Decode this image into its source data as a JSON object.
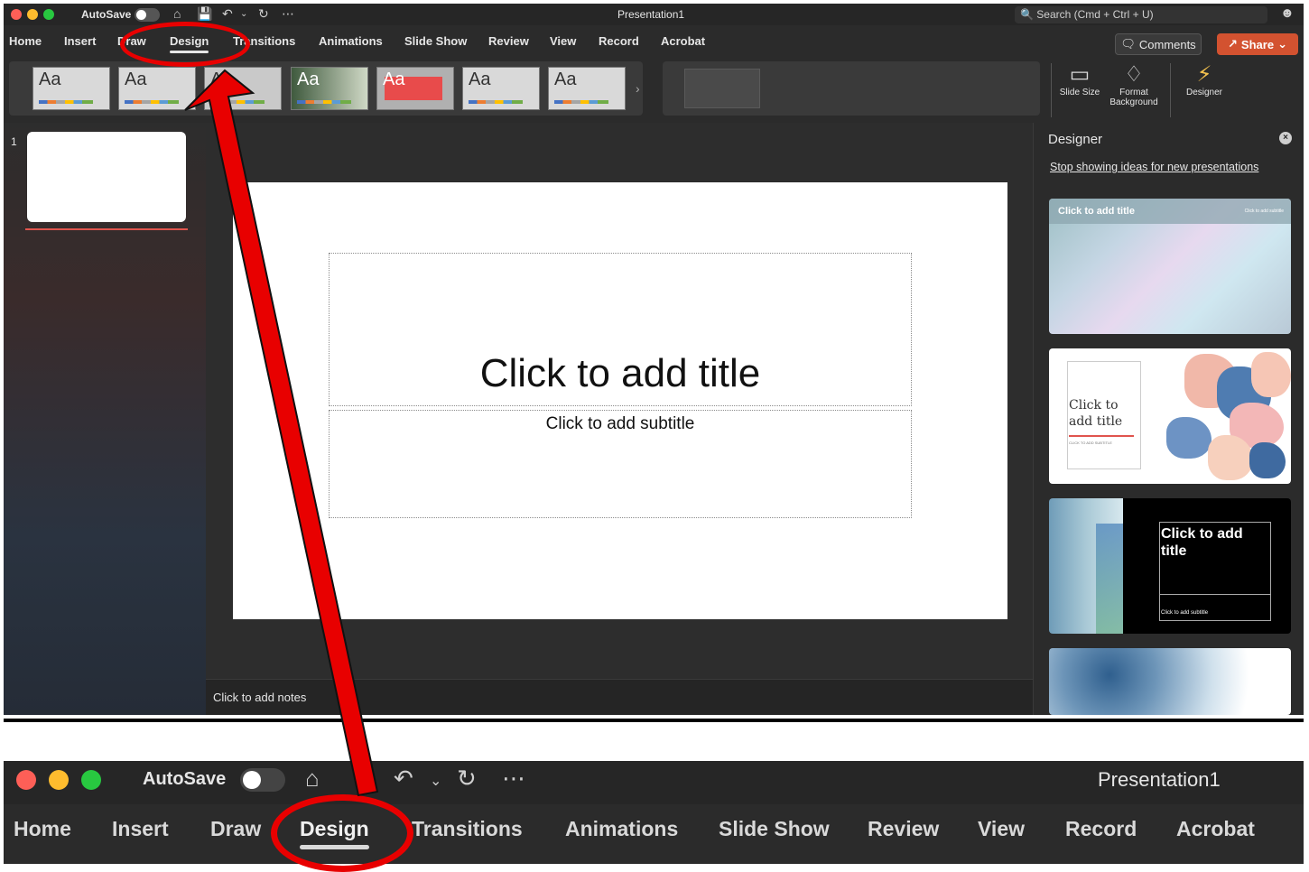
{
  "top": {
    "titlebar": {
      "autosave_label": "AutoSave",
      "doc_title": "Presentation1",
      "search_placeholder": "Search (Cmd + Ctrl + U)"
    },
    "menu": [
      "Home",
      "Insert",
      "Draw",
      "Design",
      "Transitions",
      "Animations",
      "Slide Show",
      "Review",
      "View",
      "Record",
      "Acrobat"
    ],
    "active_tab": "Design",
    "comments_label": "Comments",
    "share_label": "Share",
    "themes": [
      "Aa",
      "Aa",
      "Aa",
      "Aa",
      "Aa",
      "Aa",
      "Aa"
    ],
    "ribbon_buttons": {
      "slide_size": "Slide Size",
      "format_background": "Format Background",
      "designer": "Designer"
    },
    "slide_number": "1",
    "slide": {
      "title_placeholder": "Click to add title",
      "subtitle_placeholder": "Click to add subtitle"
    },
    "notes_placeholder": "Click to add notes",
    "designer": {
      "title": "Designer",
      "link": "Stop showing ideas for new presentations",
      "idea1_title": "Click to add title",
      "idea1_sub": "Click to add subtitle",
      "idea2_title": "Click to add title",
      "idea2_sub": "CLICK TO ADD SUBTITLE",
      "idea3_title": "Click to add title",
      "idea3_sub": "Click to add subtitle"
    }
  },
  "bottom": {
    "autosave_label": "AutoSave",
    "doc_title": "Presentation1",
    "menu": [
      "Home",
      "Insert",
      "Draw",
      "Design",
      "Transitions",
      "Animations",
      "Slide Show",
      "Review",
      "View",
      "Record",
      "Acrobat"
    ],
    "active_tab": "Design"
  },
  "colors": {
    "annotation": "#e80000",
    "share_button": "#d35230",
    "thumb_underline": "#e0544d"
  }
}
